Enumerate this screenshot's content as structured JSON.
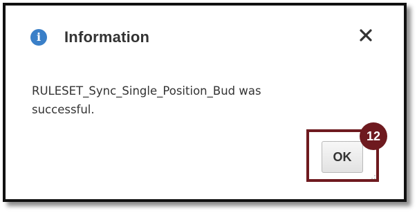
{
  "dialog": {
    "title": "Information",
    "title_icon": "info-icon",
    "close_icon": "close-icon",
    "message": "RULESET_Sync_Single_Position_Bud was successful.",
    "ok_label": "OK"
  },
  "annotation": {
    "step_number": "12",
    "color": "#6e1a1f"
  },
  "colors": {
    "info_icon": "#3a7fc8",
    "text": "#333333"
  }
}
